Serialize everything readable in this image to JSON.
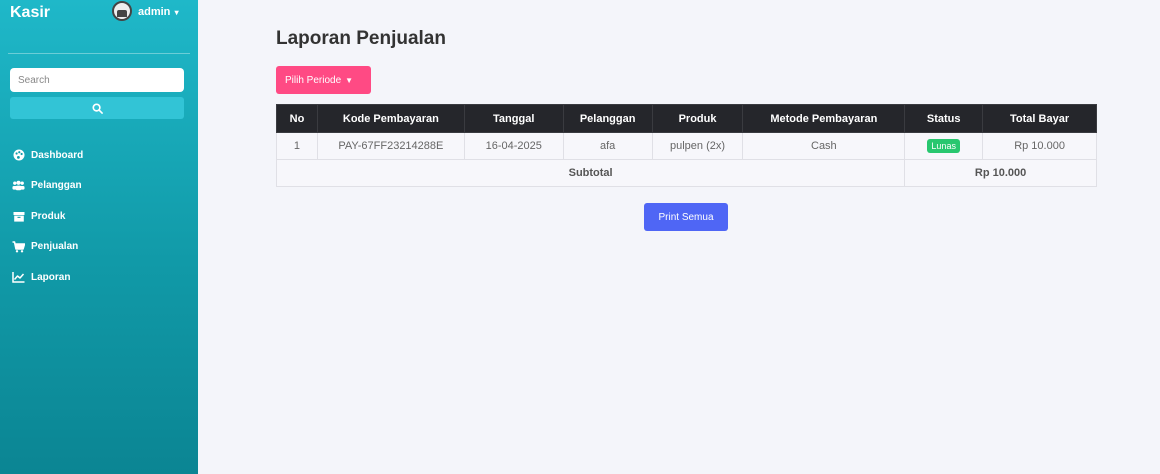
{
  "sidebar": {
    "brand": "Kasir",
    "user": "admin",
    "search": {
      "placeholder": "Search",
      "value": ""
    },
    "items": [
      {
        "label": "Dashboard",
        "icon": "palette-icon"
      },
      {
        "label": "Pelanggan",
        "icon": "users-icon"
      },
      {
        "label": "Produk",
        "icon": "box-icon"
      },
      {
        "label": "Penjualan",
        "icon": "cart-icon"
      },
      {
        "label": "Laporan",
        "icon": "chart-icon"
      }
    ]
  },
  "main": {
    "title": "Laporan Penjualan",
    "period_button": "Pilih Periode",
    "print_button": "Print Semua",
    "table": {
      "headers": [
        "No",
        "Kode Pembayaran",
        "Tanggal",
        "Pelanggan",
        "Produk",
        "Metode Pembayaran",
        "Status",
        "Total Bayar"
      ],
      "rows": [
        {
          "no": "1",
          "kode": "PAY-67FF23214288E",
          "tanggal": "16-04-2025",
          "pelanggan": "afa",
          "produk": "pulpen (2x)",
          "metode": "Cash",
          "status": "Lunas",
          "total": "Rp 10.000"
        }
      ],
      "subtotal_label": "Subtotal",
      "subtotal_value": "Rp 10.000"
    }
  },
  "colors": {
    "sidebar_top": "#1fb8c9",
    "sidebar_bottom": "#0b8593",
    "period_button": "#ff4a84",
    "print_button": "#4f66f5",
    "table_header": "#25262b",
    "status_badge": "#28c76f"
  }
}
